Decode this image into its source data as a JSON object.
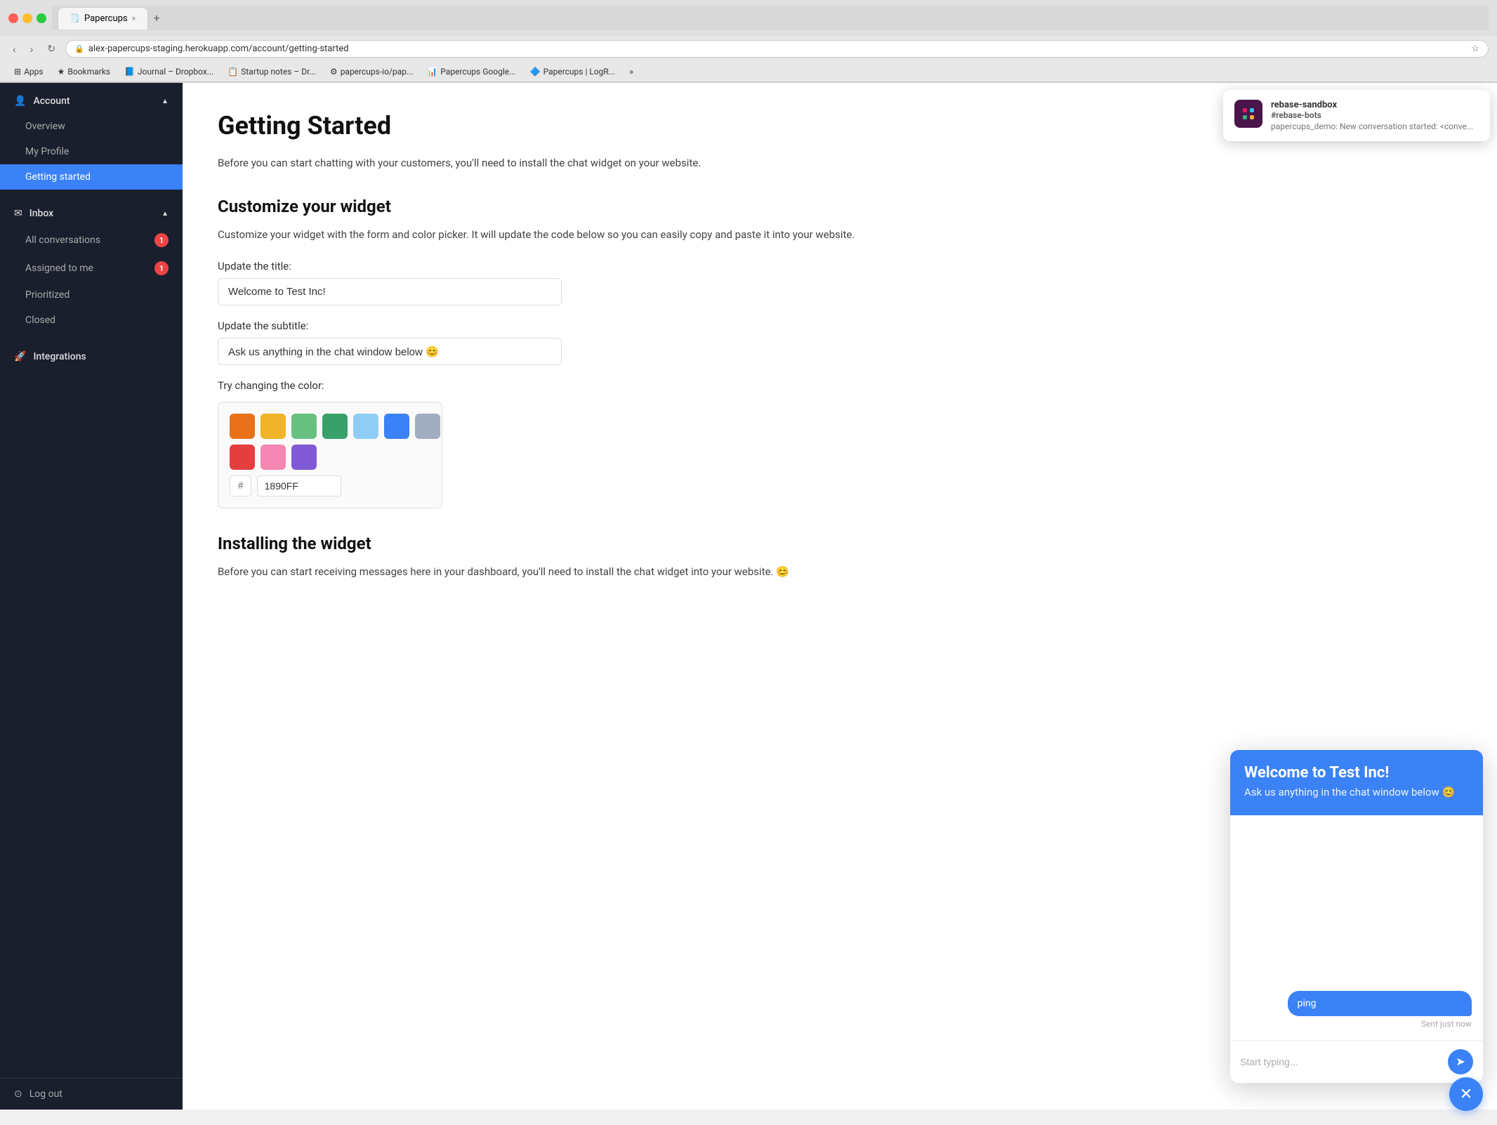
{
  "browser": {
    "tab_title": "Papercups",
    "tab_icon": "🗒️",
    "address": "alex-papercups-staging.herokuapp.com/account/getting-started",
    "back_btn": "‹",
    "forward_btn": "›",
    "reload_btn": "↻",
    "new_tab_btn": "+",
    "tab_close": "×",
    "bookmarks": [
      {
        "label": "Apps",
        "icon": "⊞"
      },
      {
        "label": "Bookmarks",
        "icon": "★"
      },
      {
        "label": "Journal – Dropbox...",
        "icon": "📘"
      },
      {
        "label": "Startup notes – Dr...",
        "icon": "📋"
      },
      {
        "label": "papercups-io/pap...",
        "icon": "⚙"
      },
      {
        "label": "Papercups Google...",
        "icon": "📊"
      },
      {
        "label": "Papercups | LogR...",
        "icon": "🔷"
      },
      {
        "label": "»",
        "icon": ""
      }
    ]
  },
  "slack_popup": {
    "workspace": "rebase-sandbox",
    "channel": "#rebase-bots",
    "message": "papercups_demo: New conversation started: <conve..."
  },
  "sidebar": {
    "account_label": "Account",
    "account_items": [
      {
        "label": "Overview",
        "active": false
      },
      {
        "label": "My Profile",
        "active": false
      },
      {
        "label": "Getting started",
        "active": true
      }
    ],
    "inbox_label": "Inbox",
    "inbox_items": [
      {
        "label": "All conversations",
        "badge": "1"
      },
      {
        "label": "Assigned to me",
        "badge": "1"
      },
      {
        "label": "Prioritized",
        "badge": null
      },
      {
        "label": "Closed",
        "badge": null
      }
    ],
    "integrations_label": "Integrations",
    "logout_label": "Log out"
  },
  "main": {
    "page_title": "Getting Started",
    "page_intro": "Before you can start chatting with your customers, you'll need to ins... website.",
    "customize_title": "Customize your widget",
    "customize_desc": "Customize your widget with the form and color picker. It will update the code below so you can easily copy and paste it into your website.",
    "title_label": "Update the title:",
    "title_value": "Welcome to Test Inc!",
    "subtitle_label": "Update the subtitle:",
    "subtitle_value": "Ask us anything in the chat window below 😊",
    "color_label": "Try changing the color:",
    "hex_prefix": "#",
    "hex_value": "1890FF",
    "colors": [
      "#e8711a",
      "#f0b429",
      "#67c080",
      "#38a169",
      "#90cdf4",
      "#3b82f6",
      "#a0aec0",
      "#e53e3e",
      "#f687b3",
      "#805ad5"
    ],
    "install_title": "Installing the widget",
    "install_intro": "Before you can start receiving messages here in your dashboard, you'll need to install the chat widget into your website. 😊"
  },
  "chat_widget": {
    "header_title": "Welcome to Test Inc!",
    "header_subtitle": "Ask us anything in the chat window below 😊",
    "message_out": "ping",
    "message_time": "Sent just now",
    "input_placeholder": "Start typing...",
    "close_icon": "×",
    "send_icon": "➤"
  }
}
